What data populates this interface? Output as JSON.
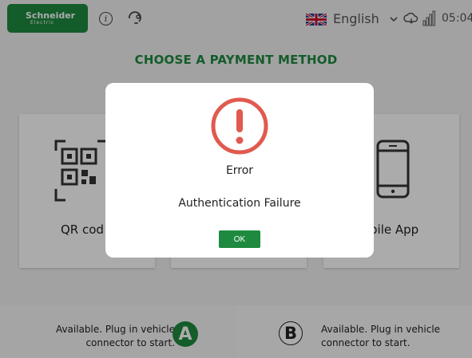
{
  "header": {
    "brand_main": "Schneider",
    "brand_sub": "Electric",
    "language": "English",
    "time": "05:04",
    "icons": [
      "info-icon",
      "support-icon",
      "uk-flag-icon",
      "chevron-down-icon",
      "cloud-icon",
      "signal-icon"
    ]
  },
  "page": {
    "title": "CHOOSE A PAYMENT METHOD",
    "methods": [
      {
        "label": "QR code",
        "visible_label": "QR cod",
        "icon": "qr-code-icon"
      },
      {
        "label": "",
        "icon": ""
      },
      {
        "label": "Mobile App",
        "visible_label": "bile App",
        "icon": "smartphone-icon"
      }
    ]
  },
  "connectors": {
    "a": {
      "letter": "A",
      "status_line1": "Available. Plug in vehicle",
      "status_line2": "connector to start.",
      "color": "#1e8a3f"
    },
    "b": {
      "letter": "B",
      "status_line1": "Available. Plug in vehicle",
      "status_line2": "connector to start."
    }
  },
  "dialog": {
    "title": "Error",
    "message": "Authentication Failure",
    "ok_label": "OK",
    "icon": "error-icon",
    "icon_color": "#e05a4f"
  },
  "colors": {
    "brand": "#1e8a3f",
    "error": "#e05a4f"
  }
}
